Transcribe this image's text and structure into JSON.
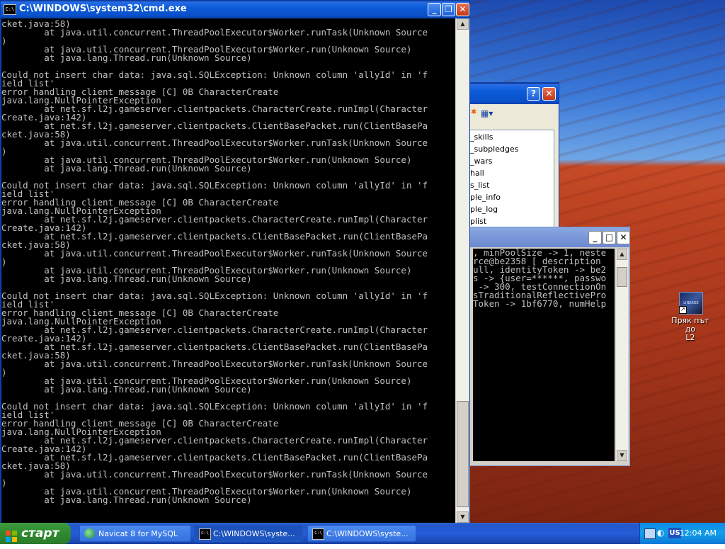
{
  "cmd_window": {
    "title": "C:\\WINDOWS\\system32\\cmd.exe",
    "lines": [
      "cket.java:58)",
      "        at java.util.concurrent.ThreadPoolExecutor$Worker.runTask(Unknown Source",
      ")",
      "        at java.util.concurrent.ThreadPoolExecutor$Worker.run(Unknown Source)",
      "        at java.lang.Thread.run(Unknown Source)",
      "",
      "Could not insert char data: java.sql.SQLException: Unknown column 'allyId' in 'f",
      "ield list'",
      "error handling client message [C] 0B CharacterCreate",
      "java.lang.NullPointerException",
      "        at net.sf.l2j.gameserver.clientpackets.CharacterCreate.runImpl(Character",
      "Create.java:142)",
      "        at net.sf.l2j.gameserver.clientpackets.ClientBasePacket.run(ClientBasePa",
      "cket.java:58)",
      "        at java.util.concurrent.ThreadPoolExecutor$Worker.runTask(Unknown Source",
      ")",
      "        at java.util.concurrent.ThreadPoolExecutor$Worker.run(Unknown Source)",
      "        at java.lang.Thread.run(Unknown Source)",
      "",
      "Could not insert char data: java.sql.SQLException: Unknown column 'allyId' in 'f",
      "ield list'",
      "error handling client message [C] 0B CharacterCreate",
      "java.lang.NullPointerException",
      "        at net.sf.l2j.gameserver.clientpackets.CharacterCreate.runImpl(Character",
      "Create.java:142)",
      "        at net.sf.l2j.gameserver.clientpackets.ClientBasePacket.run(ClientBasePa",
      "cket.java:58)",
      "        at java.util.concurrent.ThreadPoolExecutor$Worker.runTask(Unknown Source",
      ")",
      "        at java.util.concurrent.ThreadPoolExecutor$Worker.run(Unknown Source)",
      "        at java.lang.Thread.run(Unknown Source)",
      "",
      "Could not insert char data: java.sql.SQLException: Unknown column 'allyId' in 'f",
      "ield list'",
      "error handling client message [C] 0B CharacterCreate",
      "java.lang.NullPointerException",
      "        at net.sf.l2j.gameserver.clientpackets.CharacterCreate.runImpl(Character",
      "Create.java:142)",
      "        at net.sf.l2j.gameserver.clientpackets.ClientBasePacket.run(ClientBasePa",
      "cket.java:58)",
      "        at java.util.concurrent.ThreadPoolExecutor$Worker.runTask(Unknown Source",
      ")",
      "        at java.util.concurrent.ThreadPoolExecutor$Worker.run(Unknown Source)",
      "        at java.lang.Thread.run(Unknown Source)",
      "",
      "Could not insert char data: java.sql.SQLException: Unknown column 'allyId' in 'f",
      "ield list'",
      "error handling client message [C] 0B CharacterCreate",
      "java.lang.NullPointerException",
      "        at net.sf.l2j.gameserver.clientpackets.CharacterCreate.runImpl(Character",
      "Create.java:142)",
      "        at net.sf.l2j.gameserver.clientpackets.ClientBasePacket.run(ClientBasePa",
      "cket.java:58)",
      "        at java.util.concurrent.ThreadPoolExecutor$Worker.runTask(Unknown Source",
      ")",
      "        at java.util.concurrent.ThreadPoolExecutor$Worker.run(Unknown Source)",
      "        at java.lang.Thread.run(Unknown Source)"
    ]
  },
  "navicat_window": {
    "list_items": [
      "_skills",
      "_subpledges",
      "_wars",
      "hall",
      "s_list",
      "ple_info",
      "ple_log",
      "plist"
    ]
  },
  "second_console": {
    "lines": [
      ", minPoolSize -> 1, neste",
      "rce@be2358 [ description",
      "ull, identityToken -> be2",
      "s -> {user=******, passwo",
      " -> 300, testConnectionOn",
      "sTraditionalReflectivePro",
      "Token -> 1bf6770, numHelp"
    ]
  },
  "desktop_icon": {
    "label_line1": "Пряк път до",
    "label_line2": "L2",
    "image_text": "LINEAGE"
  },
  "taskbar": {
    "start_label": "старт",
    "buttons": [
      {
        "label": "Navicat 8 for MySQL",
        "icon": "navicat-icon"
      },
      {
        "label": "C:\\WINDOWS\\syste...",
        "icon": "cmd-icon"
      },
      {
        "label": "C:\\WINDOWS\\syste...",
        "icon": "cmd-icon"
      }
    ],
    "tray": {
      "lang": "US",
      "clock": "12:04 AM"
    }
  }
}
